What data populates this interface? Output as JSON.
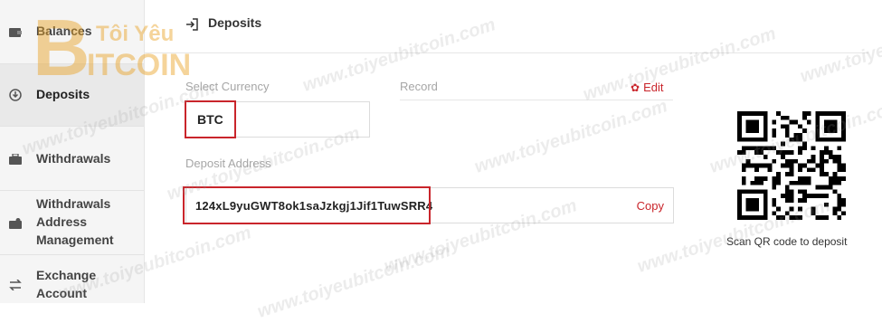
{
  "sidebar": {
    "items": [
      {
        "label": "Balances",
        "icon": "wallet-icon"
      },
      {
        "label": "Deposits",
        "icon": "download-icon",
        "active": true
      },
      {
        "label": "Withdrawals",
        "icon": "briefcase-icon"
      },
      {
        "label": "Withdrawals Address Management",
        "icon": "address-book-icon"
      },
      {
        "label": "Exchange Account",
        "icon": "exchange-icon"
      }
    ]
  },
  "header": {
    "title": "Deposits",
    "icon": "deposit-enter-icon"
  },
  "currency": {
    "label": "Select Currency",
    "value": "BTC"
  },
  "record": {
    "label": "Record",
    "edit_label": "Edit"
  },
  "address": {
    "label": "Deposit Address",
    "value": "124xL9yuGWT8ok1saJzkgj1Jif1TuwSRR4",
    "copy_label": "Copy"
  },
  "qr": {
    "caption": "Scan QR code to deposit"
  },
  "watermark": {
    "text": "www.toiyeubitcoin.com",
    "logo_text": "Tôi Yêu BITCOIN"
  },
  "colors": {
    "accent": "#c9252b",
    "sidebar_bg": "#f5f5f5",
    "border": "#dcdcdc"
  }
}
